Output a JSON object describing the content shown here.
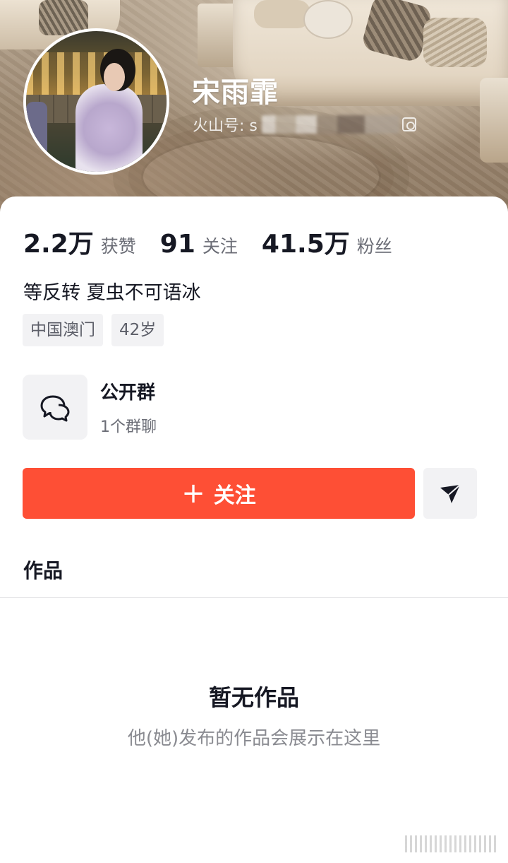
{
  "profile": {
    "name": "宋雨霏",
    "id_label": "火山号: s",
    "avatar": "profile-photo"
  },
  "stats": [
    {
      "value": "2.2万",
      "label": "获赞"
    },
    {
      "value": "91",
      "label": "关注"
    },
    {
      "value": "41.5万",
      "label": "粉丝"
    }
  ],
  "bio": "等反转 夏虫不可语冰",
  "tags": [
    "中国澳门",
    "42岁"
  ],
  "group": {
    "title": "公开群",
    "subtitle": "1个群聊",
    "icon": "chat-bubbles-icon"
  },
  "actions": {
    "follow_label": "关注",
    "follow_icon": "plus-icon",
    "send_icon": "send-icon"
  },
  "works": {
    "title": "作品",
    "empty_title": "暂无作品",
    "empty_subtitle": "他(她)发布的作品会展示在这里"
  },
  "colors": {
    "accent": "#fe4f35",
    "text_primary": "#161823",
    "text_secondary": "#6b6d76",
    "chip_bg": "#f2f2f4"
  }
}
